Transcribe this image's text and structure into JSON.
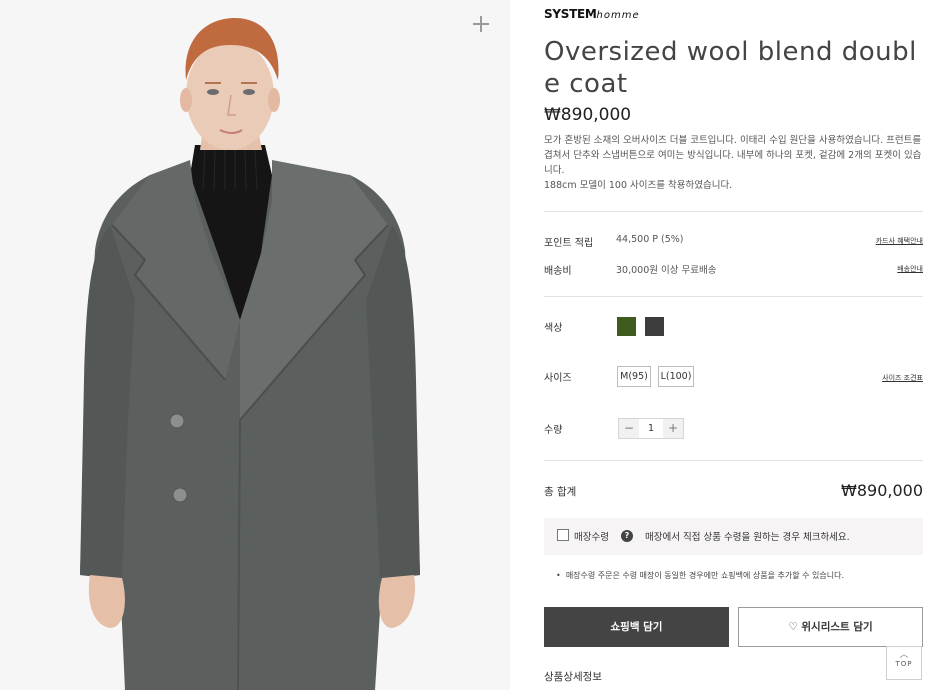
{
  "brand": {
    "name": "SYSTEM",
    "sub": "homme"
  },
  "product": {
    "title": "Oversized wool blend double coat",
    "price": "₩890,000",
    "description": [
      "모가 혼방된 소재의 오버사이즈 더블 코트입니다. 이태리 수입 원단을 사용하였습니다. 프런트를 겹쳐서 단추와 스냅버튼으로 여미는 방식입니다. 내부에 하나의 포켓, 겉감에 2개의 포켓이 있습니다.",
      "188cm 모델이 100 사이즈를 착용하였습니다."
    ]
  },
  "points": {
    "label": "포인트 적립",
    "value": "44,500 P (5%)",
    "link": "카드사 혜택안내"
  },
  "shipping": {
    "label": "배송비",
    "value": "30,000원 이상 무료배송",
    "link": "배송안내"
  },
  "color": {
    "label": "색상",
    "swatches": [
      {
        "name": "olive",
        "hex": "#3f5a1f"
      },
      {
        "name": "charcoal",
        "hex": "#3d3d3d"
      }
    ]
  },
  "size": {
    "label": "사이즈",
    "options": [
      "M(95)",
      "L(100)"
    ],
    "link": "사이즈 조견표"
  },
  "quantity": {
    "label": "수량",
    "value": "1",
    "minus": "−",
    "plus": "+"
  },
  "total": {
    "label": "총 합계",
    "price": "₩890,000"
  },
  "store_pickup": {
    "label": "매장수령",
    "help": "?",
    "text": "매장에서 직접 상품 수령을 원하는 경우 체크하세요.",
    "note": "매장수령 주문은 수령 매장이 동일한 경우에만 쇼핑백에 상품을 추가할 수 있습니다."
  },
  "buttons": {
    "cart": "쇼핑백 담기",
    "wishlist": "♡ 위시리스트 담기"
  },
  "detail_label": "상품상세정보",
  "top_button": {
    "arrow": "︿",
    "label": "TOP"
  },
  "colors": {
    "accent_dark": "#444444",
    "photo_bg": "#f7f6f7"
  }
}
